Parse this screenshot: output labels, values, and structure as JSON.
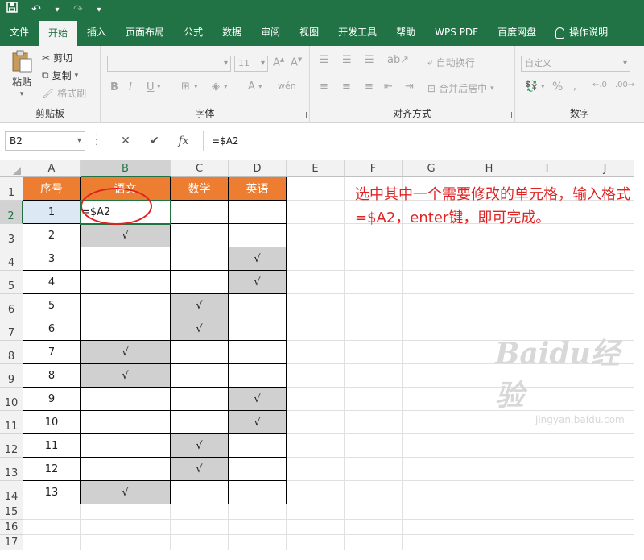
{
  "quick_access": {
    "save_icon": "save-icon",
    "undo_icon": "undo-icon",
    "redo_icon": "redo-icon",
    "customize_icon": "chevron-down-icon"
  },
  "tabs": [
    {
      "label": "文件",
      "active": false
    },
    {
      "label": "开始",
      "active": true
    },
    {
      "label": "插入",
      "active": false
    },
    {
      "label": "页面布局",
      "active": false
    },
    {
      "label": "公式",
      "active": false
    },
    {
      "label": "数据",
      "active": false
    },
    {
      "label": "审阅",
      "active": false
    },
    {
      "label": "视图",
      "active": false
    },
    {
      "label": "开发工具",
      "active": false
    },
    {
      "label": "帮助",
      "active": false
    },
    {
      "label": "WPS PDF",
      "active": false
    },
    {
      "label": "百度网盘",
      "active": false
    }
  ],
  "tell_me": "操作说明",
  "ribbon": {
    "clipboard": {
      "paste": "粘贴",
      "cut": "剪切",
      "copy": "复制",
      "format_painter": "格式刷",
      "label": "剪贴板"
    },
    "font": {
      "font_name": "",
      "font_size": "11",
      "label": "字体",
      "bold": "B",
      "italic": "I",
      "underline": "U"
    },
    "alignment": {
      "wrap_text": "自动换行",
      "merge_center": "合并后居中",
      "label": "对齐方式"
    },
    "number": {
      "format": "自定义",
      "label": "数字",
      "percent": "%"
    }
  },
  "formula_bar": {
    "name_box": "B2",
    "formula": "=$A2",
    "cancel": "✕",
    "enter": "✔",
    "fx": "fx"
  },
  "columns": [
    "A",
    "B",
    "C",
    "D",
    "E",
    "F",
    "G",
    "H",
    "I",
    "J"
  ],
  "rows": [
    "1",
    "2",
    "3",
    "4",
    "5",
    "6",
    "7",
    "8",
    "9",
    "10",
    "11",
    "12",
    "13",
    "14",
    "15",
    "16",
    "17"
  ],
  "table": {
    "headers": [
      "序号",
      "语文",
      "数学",
      "英语"
    ],
    "check_mark": "√",
    "rows": [
      {
        "num": "1",
        "checked": "B"
      },
      {
        "num": "2",
        "checked": "B"
      },
      {
        "num": "3",
        "checked": "D"
      },
      {
        "num": "4",
        "checked": "D"
      },
      {
        "num": "5",
        "checked": "C"
      },
      {
        "num": "6",
        "checked": "C"
      },
      {
        "num": "7",
        "checked": "B"
      },
      {
        "num": "8",
        "checked": "B"
      },
      {
        "num": "9",
        "checked": "D"
      },
      {
        "num": "10",
        "checked": "D"
      },
      {
        "num": "11",
        "checked": "C"
      },
      {
        "num": "12",
        "checked": "C"
      },
      {
        "num": "13",
        "checked": "B"
      }
    ],
    "editing_cell_value": "=$A2"
  },
  "annotation": "选中其中一个需要修改的单元格，输入格式=$A2，enter键，即可完成。",
  "watermark": {
    "brand": "Baidu经验",
    "url": "jingyan.baidu.com"
  },
  "colors": {
    "excel_green": "#217346",
    "header_orange": "#ed7d31",
    "checked_gray": "#d0d0d0",
    "annotation_red": "#e02424"
  }
}
